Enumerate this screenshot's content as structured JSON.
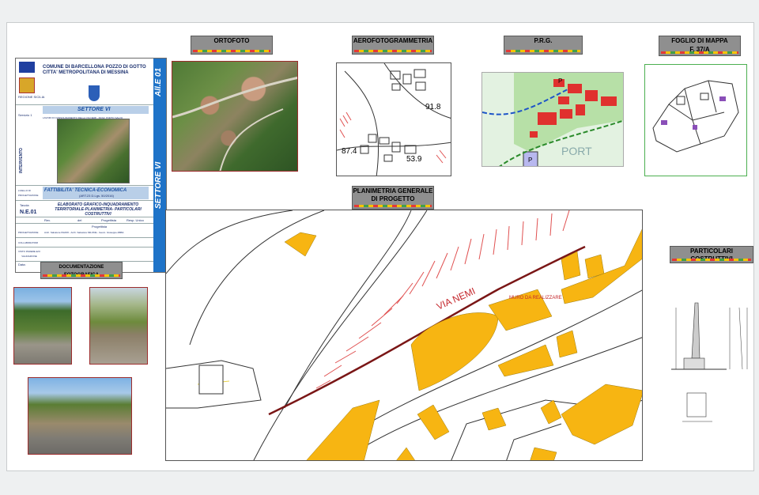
{
  "title_block": {
    "comune": "COMUNE DI BARCELLONA POZZO DI GOTTO",
    "citta": "CITTA' METROPOLITANA DI MESSINA",
    "regione": "REGIONE SICILIA",
    "servizio": "Servizio 1",
    "settore": "SETTORE VI",
    "intervento_label": "INTERVENTO",
    "lavori": "LAVORI DI CONSOLIDAMENTO DELLA VIA NEMI - FRAZ. PORTO SALVO",
    "fase": "FATTIBILITA' TECNICA-ECONOMICA",
    "fase_note": "(ART.23 D.Lgs. 50/2016)",
    "livello": "LIVELLO DI PROGETTAZIONE",
    "tavola_label": "Tavola",
    "tavola": "N.E.01",
    "elaborato": "ELABORATO GRAFICO-INQUADRAMENTO TERRITORIALE-PLANIMETRIA- PARTICOLARI COSTRUTTIVI",
    "col_rev": "Rev.",
    "col_del": "del",
    "col_prog": "Progettista",
    "col_resp": "Resp. Unico",
    "progettista_label": "Progettista",
    "progettisti": "Arch. Salvatore PAZZO - Arch. Salvatore MILONE - Geom. Giuseppe ABBA",
    "progettazione": "PROGETTAZIONE",
    "collaboratori": "COLLABORATORI",
    "visto": "VISTO PARERE E/O VALIDAZIONE",
    "data": "Data:",
    "allegato": "All.E 01",
    "settore_vert": "SETTORE VI"
  },
  "labels": {
    "ortofoto": "ORTOFOTO",
    "aerofoto": "AEROFOTOGRAMMETRIA",
    "prg": "P.R.G.",
    "foglio": "FOGLIO DI MAPPA",
    "foglio_num": "F. 37/A",
    "planimetria": "PLANIMETRIA GENERALE DI PROGETTO",
    "documentazione": "DOCUMENTAZIONE FOTOGRAFICA",
    "particolari": "PARTICOLARI COSTRUTTIVI"
  },
  "aerofoto": {
    "q1": "91.8",
    "q2": "87.4",
    "q3": "53.9"
  },
  "prg": {
    "p1": "P",
    "p2": "P",
    "port": "PORT"
  },
  "planimetria": {
    "via": "VIA NEMI",
    "muro": "MURO DA REALIZZARE"
  },
  "colors": {
    "accent_blue": "#1e73c8",
    "building": "#f7b512",
    "road": "#7a1616",
    "hatch": "#e05050"
  }
}
